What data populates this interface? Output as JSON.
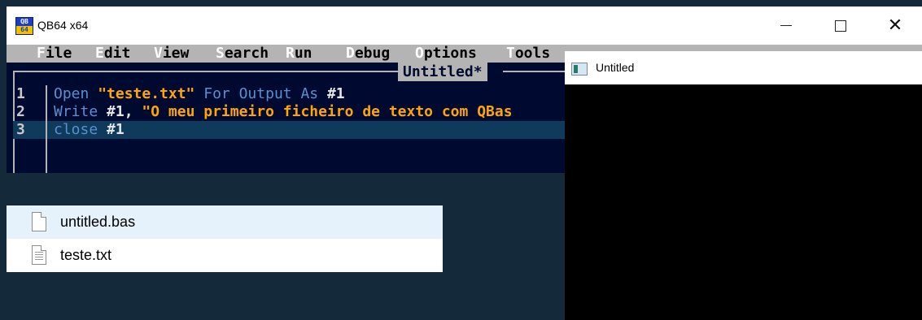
{
  "qb_window": {
    "title": "QB64 x64",
    "icon_top": "QB",
    "icon_bottom": "64",
    "controls": {
      "minimize": "—",
      "maximize": "☐",
      "close": "✕"
    },
    "menu": [
      {
        "hotkey": "F",
        "rest": "ile"
      },
      {
        "hotkey": "E",
        "rest": "dit"
      },
      {
        "hotkey": "V",
        "rest": "iew"
      },
      {
        "hotkey": "S",
        "rest": "earch"
      },
      {
        "hotkey": "R",
        "rest": "un"
      },
      {
        "hotkey": "D",
        "rest": "ebug"
      },
      {
        "hotkey": "O",
        "rest": "ptions"
      },
      {
        "hotkey": "T",
        "rest": "ools"
      }
    ],
    "editor_title": "Untitled*",
    "lines": [
      {
        "num": "1",
        "kw1": "Open ",
        "str": "\"teste.txt\"",
        "kw2": " For Output As ",
        "tail": "#1"
      },
      {
        "num": "2",
        "kw1": "Write ",
        "tail": "#1, ",
        "str": "\"O meu primeiro ficheiro de texto com QBas"
      },
      {
        "num": "3",
        "kw1": "close ",
        "tail": "#1"
      }
    ]
  },
  "output_window": {
    "title": "Untitled"
  },
  "files": [
    {
      "name": "untitled.bas",
      "icon": "blank-document-icon",
      "selected": true
    },
    {
      "name": "teste.txt",
      "icon": "text-document-icon",
      "selected": false
    }
  ],
  "colors": {
    "editor_bg": "#000a30",
    "menubar_bg": "#b4b4b4",
    "keyword": "#5a8fd0",
    "string": "#ffa500",
    "desktop_bg": "#14293a"
  }
}
